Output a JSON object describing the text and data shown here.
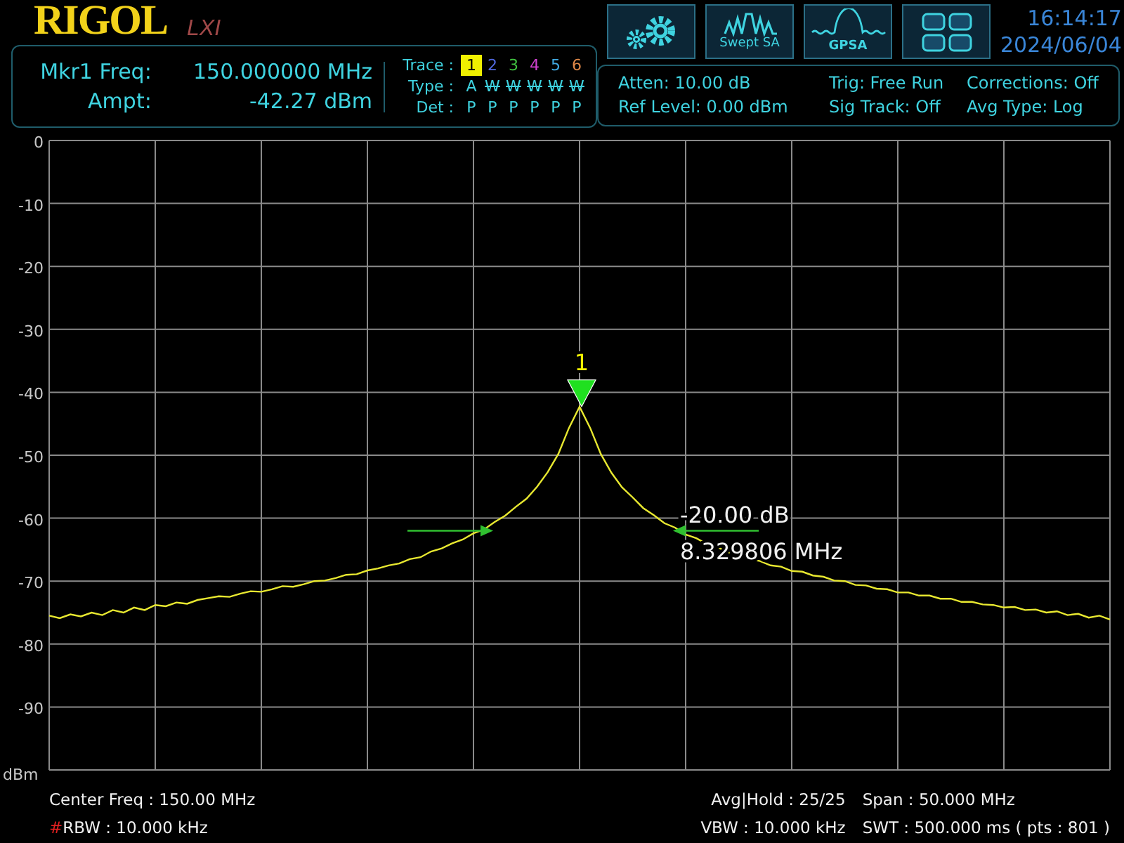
{
  "logo": {
    "brand": "RIGOL",
    "badge": "LXI"
  },
  "toolbar": [
    {
      "kind": "settings"
    },
    {
      "kind": "swept",
      "label": "Swept SA"
    },
    {
      "kind": "gpsa",
      "label": "GPSA"
    },
    {
      "kind": "layout"
    }
  ],
  "clock": {
    "time": "16:14:17",
    "date": "2024/06/04"
  },
  "marker_readout": {
    "freq_label": "Mkr1 Freq:",
    "freq_value": "150.000000 MHz",
    "ampt_label": "Ampt:",
    "ampt_value": "-42.27 dBm"
  },
  "traces": {
    "trace_label": "Trace :",
    "type_label": "Type :",
    "det_label": "Det :",
    "items": [
      {
        "number": "1",
        "color": "#f0f000",
        "selected": true,
        "type": "A",
        "blanked": false,
        "det": "P"
      },
      {
        "number": "2",
        "color": "#5068e0",
        "selected": false,
        "type": "W",
        "blanked": true,
        "det": "P"
      },
      {
        "number": "3",
        "color": "#40c040",
        "selected": false,
        "type": "W",
        "blanked": true,
        "det": "P"
      },
      {
        "number": "4",
        "color": "#d040d0",
        "selected": false,
        "type": "W",
        "blanked": true,
        "det": "P"
      },
      {
        "number": "5",
        "color": "#40a8e0",
        "selected": false,
        "type": "W",
        "blanked": true,
        "det": "P"
      },
      {
        "number": "6",
        "color": "#e08848",
        "selected": false,
        "type": "W",
        "blanked": true,
        "det": "P"
      }
    ]
  },
  "settings": [
    [
      "Atten: 10.00 dB",
      "Ref Level: 0.00 dBm"
    ],
    [
      "Trig: Free Run",
      "Sig Track: Off"
    ],
    [
      "Corrections: Off",
      "Avg Type: Log"
    ]
  ],
  "plot": {
    "chart_data": {
      "type": "line",
      "ylabel": "dBm",
      "ylim": [
        -100,
        0
      ],
      "grid": true,
      "yticks": [
        {
          "value": 0,
          "label": "0"
        },
        {
          "value": -10,
          "label": "-10"
        },
        {
          "value": -20,
          "label": "-20"
        },
        {
          "value": -30,
          "label": "-30"
        },
        {
          "value": -40,
          "label": "-40"
        },
        {
          "value": -50,
          "label": "-50"
        },
        {
          "value": -60,
          "label": "-60"
        },
        {
          "value": -70,
          "label": "-70"
        },
        {
          "value": -80,
          "label": "-80"
        },
        {
          "value": -90,
          "label": "-90"
        }
      ],
      "categories": [
        null,
        null,
        null,
        null,
        null,
        null,
        null,
        null,
        null,
        null,
        null,
        null,
        null,
        null,
        null,
        null,
        null,
        null,
        null,
        null,
        null,
        null,
        null,
        null,
        null,
        null,
        null,
        null,
        null,
        null,
        null,
        null,
        null,
        null,
        null,
        null,
        null,
        null,
        null,
        null,
        null,
        null,
        null,
        null,
        null,
        null,
        null,
        null,
        null,
        null,
        null,
        null,
        null,
        null,
        null,
        null,
        null,
        null,
        null,
        null,
        null,
        null,
        null,
        null,
        null,
        null,
        null,
        null,
        null,
        null,
        null,
        null,
        null,
        null,
        null,
        null,
        null,
        null,
        null,
        null,
        null,
        null,
        null,
        null,
        null,
        null,
        null,
        null,
        null,
        null,
        null,
        null,
        null,
        null,
        null,
        null,
        null,
        null,
        null,
        null,
        null
      ],
      "series": [
        {
          "color": "#e8e830",
          "values": [
            -75.5,
            -75.9,
            -75.3,
            -75.6,
            -75.0,
            -75.4,
            -74.6,
            -75.0,
            -74.2,
            -74.6,
            -73.8,
            -74.0,
            -73.4,
            -73.6,
            -73.0,
            -72.7,
            -72.4,
            -72.5,
            -72.0,
            -71.6,
            -71.7,
            -71.3,
            -70.8,
            -70.9,
            -70.5,
            -70.0,
            -69.9,
            -69.5,
            -69.0,
            -68.9,
            -68.3,
            -68.0,
            -67.5,
            -67.2,
            -66.5,
            -66.2,
            -65.3,
            -64.8,
            -64.0,
            -63.4,
            -62.4,
            -61.8,
            -60.6,
            -59.6,
            -58.2,
            -56.9,
            -55.0,
            -52.7,
            -49.8,
            -45.7,
            -42.3,
            -45.7,
            -49.8,
            -52.8,
            -55.1,
            -56.7,
            -58.4,
            -59.5,
            -60.8,
            -61.5,
            -62.6,
            -63.2,
            -64.1,
            -64.6,
            -65.4,
            -65.8,
            -66.5,
            -66.8,
            -67.5,
            -67.7,
            -68.4,
            -68.5,
            -69.1,
            -69.3,
            -69.9,
            -70.0,
            -70.6,
            -70.7,
            -71.2,
            -71.3,
            -71.8,
            -71.8,
            -72.3,
            -72.3,
            -72.8,
            -72.8,
            -73.3,
            -73.3,
            -73.7,
            -73.8,
            -74.2,
            -74.1,
            -74.6,
            -74.5,
            -75.0,
            -74.8,
            -75.4,
            -75.2,
            -75.8,
            -75.5,
            -76.1
          ]
        }
      ]
    },
    "marker": {
      "number": "1"
    },
    "ndb": {
      "level": "-20.00 dB",
      "bandwidth": "8.329806 MHz"
    }
  },
  "footer": [
    [
      {
        "text": "Center Freq : 150.00 MHz"
      },
      {
        "flag": "#",
        "text": "RBW : 10.000 kHz"
      }
    ],
    [
      {
        "text": "Avg|Hold : 25/25"
      },
      {
        "text": "VBW : 10.000 kHz"
      }
    ],
    [
      {
        "text": "Span : 50.000 MHz"
      },
      {
        "text": "SWT : 500.000 ms ( pts : 801 )"
      }
    ]
  ]
}
